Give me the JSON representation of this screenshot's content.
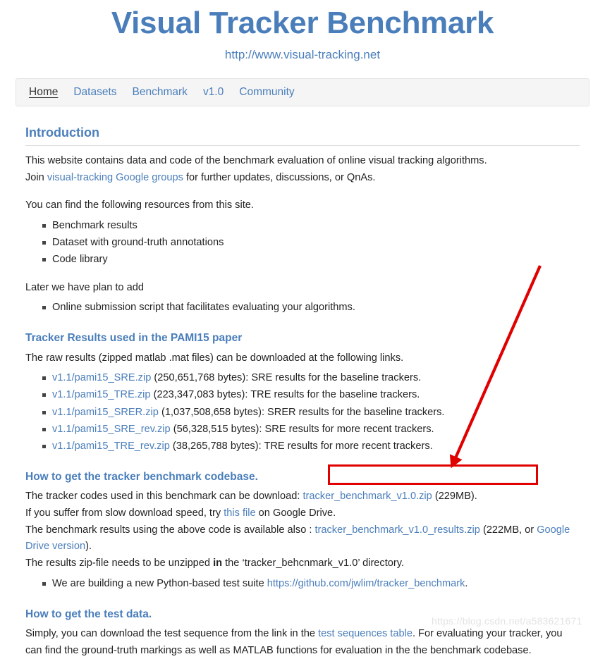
{
  "header": {
    "title": "Visual Tracker Benchmark",
    "subtitle": "http://www.visual-tracking.net",
    "title_color": "#4a7ebb"
  },
  "nav": {
    "items": [
      {
        "label": "Home",
        "active": true
      },
      {
        "label": "Datasets",
        "active": false
      },
      {
        "label": "Benchmark",
        "active": false
      },
      {
        "label": "v1.0",
        "active": false
      },
      {
        "label": "Community",
        "active": false
      }
    ]
  },
  "introduction": {
    "heading": "Introduction",
    "line1": "This website contains data and code of the benchmark evaluation of online visual tracking algorithms.",
    "line2_pre": "Join ",
    "line2_link": "visual-tracking Google groups",
    "line2_post": " for further updates, discussions, or QnAs.",
    "resources_intro": "You can find the following resources from this site.",
    "resources": [
      "Benchmark results",
      "Dataset with ground-truth annotations",
      "Code library"
    ],
    "later_intro": "Later we have plan to add",
    "later_items": [
      "Online submission script that facilitates evaluating your algorithms."
    ]
  },
  "pami15": {
    "heading": "Tracker Results used in the PAMI15 paper",
    "intro": "The raw results (zipped matlab .mat files) can be downloaded at the following links.",
    "links": [
      {
        "file": "v1.1/pami15_SRE.zip",
        "size": "(250,651,768 bytes)",
        "desc": ": SRE results for the baseline trackers."
      },
      {
        "file": "v1.1/pami15_TRE.zip",
        "size": "(223,347,083 bytes)",
        "desc": ": TRE results for the baseline trackers."
      },
      {
        "file": "v1.1/pami15_SRER.zip",
        "size": "(1,037,508,658 bytes)",
        "desc": ": SRER results for the baseline trackers."
      },
      {
        "file": "v1.1/pami15_SRE_rev.zip",
        "size": "(56,328,515 bytes)",
        "desc": ": SRE results for more recent trackers."
      },
      {
        "file": "v1.1/pami15_TRE_rev.zip",
        "size": "(38,265,788 bytes)",
        "desc": ": TRE results for more recent trackers."
      }
    ]
  },
  "codebase": {
    "heading": "How to get the tracker benchmark codebase.",
    "line1_pre": "The tracker codes used in this benchmark can be download: ",
    "line1_link": "tracker_benchmark_v1.0.zip",
    "line1_post": " (229MB).",
    "line2_pre": "If you suffer from slow download speed, try ",
    "line2_link": "this file",
    "line2_post": " on Google Drive.",
    "line3_pre": "The benchmark results using the above code is available also : ",
    "line3_link": "tracker_benchmark_v1.0_results.zip",
    "line3_mid": " (222MB, or ",
    "line3_link2": "Google Drive version",
    "line3_post": ").",
    "line4_pre": "The results zip-file needs to be unzipped ",
    "line4_bold": "in",
    "line4_post": " the ‘tracker_behcnmark_v1.0’ directory.",
    "bullet_pre": "We are building a new Python-based test suite ",
    "bullet_link": "https://github.com/jwlim/tracker_benchmark",
    "bullet_post": "."
  },
  "testdata": {
    "heading": "How to get the test data.",
    "line_pre": "Simply, you can download the test sequence from the link in the ",
    "line_link": "test sequences table",
    "line_post": ". For evaluating your tracker, you can find the ground-truth markings as well as MATLAB functions for evaluation in the the benchmark codebase."
  },
  "annotations": {
    "highlight_color": "#e00000",
    "arrow_label": "red-arrow-pointing-to-download-link",
    "box_label": "red-highlight-box-around-download-link",
    "watermark": "https://blog.csdn.net/a583621671"
  }
}
